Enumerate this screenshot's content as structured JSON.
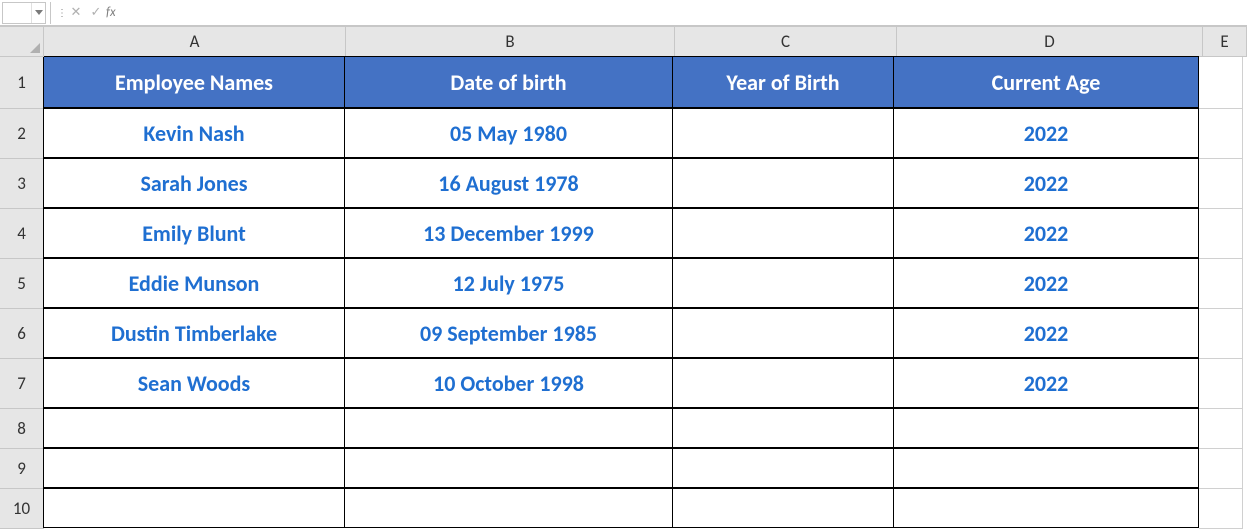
{
  "namebox_value": "",
  "formula_value": "",
  "fx_label": "fx",
  "cancel_glyph": "✕",
  "enter_glyph": "✓",
  "col_letters": [
    "A",
    "B",
    "C",
    "D",
    "E"
  ],
  "row_numbers": [
    "1",
    "2",
    "3",
    "4",
    "5",
    "6",
    "7",
    "8",
    "9",
    "10"
  ],
  "headers": {
    "A": "Employee Names",
    "B": "Date of birth",
    "C": "Year of Birth",
    "D": "Current Age"
  },
  "rows": [
    {
      "A": "Kevin Nash",
      "B": "05 May 1980",
      "C": "",
      "D": "2022"
    },
    {
      "A": "Sarah Jones",
      "B": "16 August 1978",
      "C": "",
      "D": "2022"
    },
    {
      "A": "Emily Blunt",
      "B": "13 December 1999",
      "C": "",
      "D": "2022"
    },
    {
      "A": "Eddie Munson",
      "B": "12 July 1975",
      "C": "",
      "D": "2022"
    },
    {
      "A": "Dustin Timberlake",
      "B": "09 September 1985",
      "C": "",
      "D": "2022"
    },
    {
      "A": "Sean Woods",
      "B": "10 October 1998",
      "C": "",
      "D": "2022"
    }
  ]
}
